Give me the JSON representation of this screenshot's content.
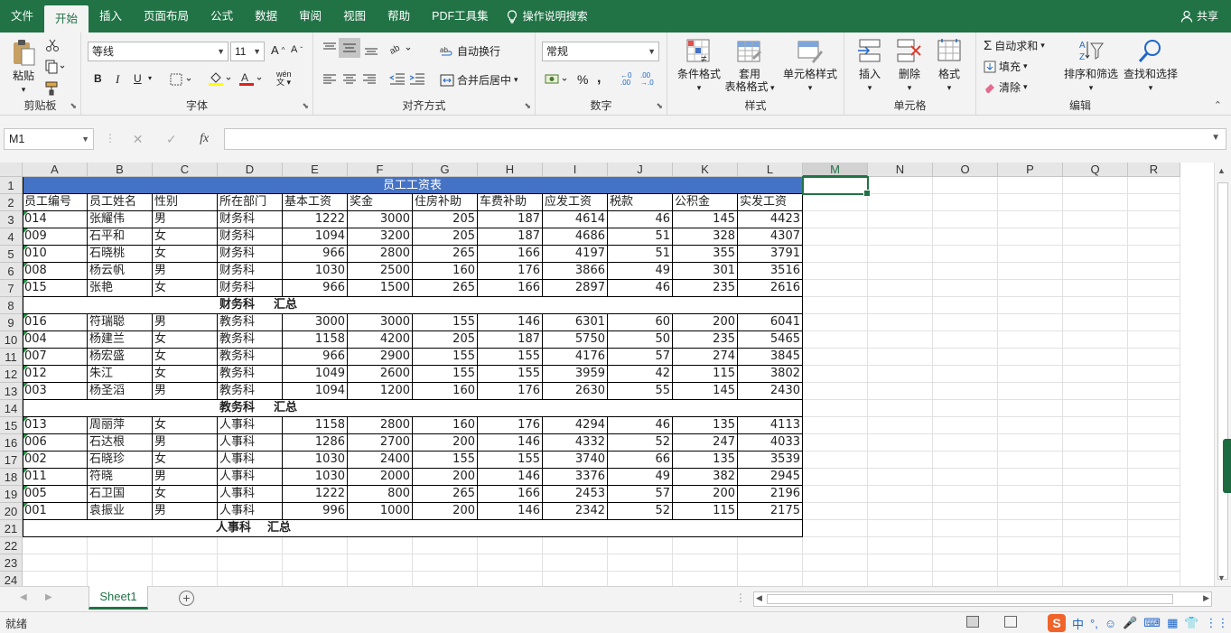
{
  "menu": {
    "tabs": [
      "文件",
      "开始",
      "插入",
      "页面布局",
      "公式",
      "数据",
      "审阅",
      "视图",
      "帮助",
      "PDF工具集"
    ],
    "active_index": 1,
    "search_label": "操作说明搜索",
    "share_label": "共享"
  },
  "ribbon": {
    "clipboard": {
      "label": "剪贴板",
      "paste": "粘贴"
    },
    "font": {
      "label": "字体",
      "font_name": "等线",
      "font_size": "11",
      "bold": "B",
      "italic": "I",
      "underline": "U",
      "phonetic": "wén"
    },
    "alignment": {
      "label": "对齐方式",
      "wrap_text": "自动换行",
      "merge_center": "合并后居中"
    },
    "number": {
      "label": "数字",
      "format": "常规",
      "percent": "%",
      "comma": ","
    },
    "styles": {
      "label": "样式",
      "conditional": "条件格式",
      "table_format_1": "套用",
      "table_format_2": "表格格式",
      "cell_styles": "单元格样式"
    },
    "cells": {
      "label": "单元格",
      "insert": "插入",
      "delete": "删除",
      "format": "格式"
    },
    "editing": {
      "label": "编辑",
      "autosum": "自动求和",
      "fill": "填充",
      "clear": "清除",
      "sort_filter": "排序和筛选",
      "find_select": "查找和选择"
    }
  },
  "formula_bar": {
    "name_box": "M1",
    "fx": "fx",
    "formula": ""
  },
  "sheet": {
    "columns": [
      "A",
      "B",
      "C",
      "D",
      "E",
      "F",
      "G",
      "H",
      "I",
      "J",
      "K",
      "L",
      "M",
      "N",
      "O",
      "P",
      "Q",
      "R"
    ],
    "selected_column": "M",
    "row_numbers": [
      "1",
      "2",
      "3",
      "4",
      "5",
      "6",
      "7",
      "8",
      "9",
      "10",
      "11",
      "12",
      "13",
      "14",
      "15",
      "16",
      "17",
      "18",
      "19",
      "20",
      "21",
      "22",
      "23",
      "24"
    ],
    "title": "员工工资表",
    "headers": [
      "员工编号",
      "员工姓名",
      "性别",
      "所在部门",
      "基本工资",
      "奖金",
      "住房补助",
      "车费补助",
      "应发工资",
      "税款",
      "公积金",
      "实发工资"
    ],
    "rows": [
      {
        "type": "data",
        "cells": [
          "014",
          "张耀伟",
          "男",
          "财务科",
          "1222",
          "3000",
          "205",
          "187",
          "4614",
          "46",
          "145",
          "4423"
        ]
      },
      {
        "type": "data",
        "cells": [
          "009",
          "石平和",
          "女",
          "财务科",
          "1094",
          "3200",
          "205",
          "187",
          "4686",
          "51",
          "328",
          "4307"
        ]
      },
      {
        "type": "data",
        "cells": [
          "010",
          "石晓桃",
          "女",
          "财务科",
          "966",
          "2800",
          "265",
          "166",
          "4197",
          "51",
          "355",
          "3791"
        ]
      },
      {
        "type": "data",
        "cells": [
          "008",
          "杨云帆",
          "男",
          "财务科",
          "1030",
          "2500",
          "160",
          "176",
          "3866",
          "49",
          "301",
          "3516"
        ]
      },
      {
        "type": "data",
        "cells": [
          "015",
          "张艳",
          "女",
          "财务科",
          "966",
          "1500",
          "265",
          "166",
          "2897",
          "46",
          "235",
          "2616"
        ]
      },
      {
        "type": "summary",
        "dept": "财务科",
        "suffix": "汇总"
      },
      {
        "type": "data",
        "cells": [
          "016",
          "符瑞聪",
          "男",
          "教务科",
          "3000",
          "3000",
          "155",
          "146",
          "6301",
          "60",
          "200",
          "6041"
        ]
      },
      {
        "type": "data",
        "cells": [
          "004",
          "杨建兰",
          "女",
          "教务科",
          "1158",
          "4200",
          "205",
          "187",
          "5750",
          "50",
          "235",
          "5465"
        ]
      },
      {
        "type": "data",
        "cells": [
          "007",
          " 杨宏盛",
          "女",
          "教务科",
          "966",
          "2900",
          "155",
          "155",
          "4176",
          "57",
          "274",
          "3845"
        ]
      },
      {
        "type": "data",
        "cells": [
          "012",
          "朱江",
          "女",
          "教务科",
          "1049",
          "2600",
          "155",
          "155",
          "3959",
          "42",
          "115",
          "3802"
        ]
      },
      {
        "type": "data",
        "cells": [
          "003",
          "杨圣滔",
          "男",
          "教务科",
          "1094",
          "1200",
          "160",
          "176",
          "2630",
          "55",
          "145",
          "2430"
        ]
      },
      {
        "type": "summary",
        "dept": "教务科",
        "suffix": "汇总"
      },
      {
        "type": "data",
        "cells": [
          "013",
          "周丽萍",
          "女",
          "人事科",
          "1158",
          "2800",
          "160",
          "176",
          "4294",
          "46",
          "135",
          "4113"
        ]
      },
      {
        "type": "data",
        "cells": [
          "006",
          "石达根",
          "男",
          "人事科",
          "1286",
          "2700",
          "200",
          "146",
          "4332",
          "52",
          "247",
          "4033"
        ]
      },
      {
        "type": "data",
        "cells": [
          "002",
          "石晓珍",
          "女",
          "人事科",
          "1030",
          "2400",
          "155",
          "155",
          "3740",
          "66",
          "135",
          "3539"
        ]
      },
      {
        "type": "data",
        "cells": [
          "011",
          "符晓",
          "男",
          "人事科",
          "1030",
          "2000",
          "200",
          "146",
          "3376",
          "49",
          "382",
          "2945"
        ]
      },
      {
        "type": "data",
        "cells": [
          "005",
          "石卫国",
          "女",
          "人事科",
          "1222",
          "800",
          "265",
          "166",
          "2453",
          "57",
          "200",
          "2196"
        ]
      },
      {
        "type": "data",
        "cells": [
          "001",
          "袁振业",
          "男",
          "人事科",
          "996",
          "1000",
          "200",
          "146",
          "2342",
          "52",
          "115",
          "2175"
        ]
      },
      {
        "type": "summary",
        "dept": "人事科",
        "suffix": "汇总"
      }
    ]
  },
  "sheet_tabs": {
    "active": "Sheet1",
    "add": "+"
  },
  "status": {
    "text": "就绪",
    "ime": [
      "中",
      "°,",
      "☺",
      "🎤",
      "⌨",
      "▦",
      "👕",
      "⋮⋮"
    ]
  },
  "colors": {
    "excel_green": "#217346",
    "title_fill": "#4472c4"
  }
}
